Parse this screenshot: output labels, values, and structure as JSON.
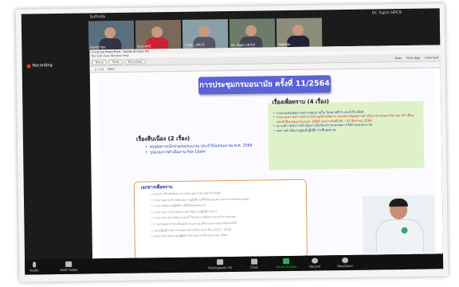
{
  "participants": [
    {
      "name": "Suthida"
    },
    {
      "name": "kaset hpc"
    },
    {
      "name": "Krai-HPC"
    },
    {
      "name": "วรรณา_HPC9"
    },
    {
      "name": "Dr. Yupin HPC9"
    }
  ],
  "top_names": {
    "left": "Suthida",
    "right": "Dr. Yupin HPC9"
  },
  "recording": "Recording",
  "viewer": {
    "titlebar": "การประชุม PowerPoint - Adobe Acrobat Pro",
    "menubar": "File Edit View Window Help",
    "home": "Home",
    "tools": "Tools",
    "document": "Document",
    "page_indicator": "1 / 14",
    "zoom": "69%",
    "right_tools": [
      "Tools",
      "Fill & Sign",
      "Comment"
    ]
  },
  "slide": {
    "title": "การประชุมกรมอนามัย ครั้งที่ 11/2564",
    "info": {
      "heading": "เรื่องเพื่อทราบ (4 เรื่อง)",
      "items": [
        {
          "text": "รายงานสรุปผลการตรวจสอบภายใน ไตรมาสที่ 3 ประจำปี 2564",
          "color": "blue"
        },
        {
          "text": "รายงานความก้าวหน้าการประมูลจ้างจัดหาฯ และประเมินผลการดำเนินงานกรมอนามัย รอบ 12 เดือน ประจำปีงบประมาณ พ.ศ. 2564 ระหว่างวันที่ 26 – 27 สิงหาคม 2564",
          "color": "red"
        },
        {
          "text": "ความก้าวหน้าการดำเนินงานในโครงการและผลการใช้จ่ายงบประมาณ",
          "color": "blue"
        },
        {
          "text": "ผลการดำเนินงานศูนย์ปฏิบัติการเพื่อสุขภาพ",
          "color": "blue"
        }
      ]
    },
    "continuing": {
      "heading": "เรื่องสืบเนื่อง (2 เรื่อง)",
      "items": [
        "สรุปผลการเบิกจ่ายงบประมาณ ประจำปีงบประมาณ พ.ศ. 2564",
        "รูปแบบการดำเนินงาน Fax Claim"
      ]
    },
    "documents": {
      "heading": "เอกสารเพื่อทราบ",
      "items": [
        "สรุปประเด็นสำคัญจากการประชุมกระทรวงสาธารณสุข",
        "รายงานความก้าวหน้าผลการปฏิบัติงานที่ได้รับมอบหมายกระทรวงสาธารณสุข",
        "รายงานผลการปฏิบัติงานที่ได้รับมอบหมาย",
        "รายงานความก้าวหน้าการดำเนินงานปฏิบัติราชการ",
        "รายงานการประเมินความเข้าใจเอกสารเพื่อทราบประจำการประชุม",
        "รายงานผลการประเมินผู้เข้าร่วมประชุมกิจกรรมกรมอนามัยประจำปี",
        "แผนปฏิบัติราชการกรมอนามัย (SDG CCO Kit) 2022 – 2026",
        "สรุปการดำเนินงานปฏิบัติราชการประจำปีงบประมาณ 2564"
      ]
    }
  },
  "bottom_controls": {
    "audio": "Audio",
    "video": "Start Video",
    "participants": "Participants",
    "participants_count": "32",
    "chat": "Chat",
    "share": "Share Screen",
    "record": "Record",
    "reactions": "Reactions"
  }
}
